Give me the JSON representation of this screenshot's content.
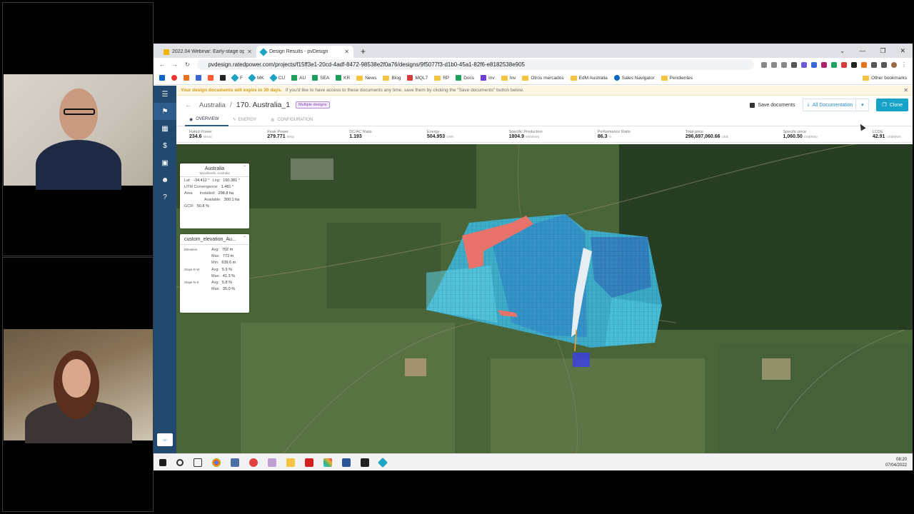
{
  "browser": {
    "tabs": [
      {
        "title": "2022.04 Webinar: Early-stage optim",
        "active": false
      },
      {
        "title": "Design Results - pvDesign",
        "active": true
      }
    ],
    "url": "pvdesign.ratedpower.com/projects/f15ff3e1-20cd-4adf-8472-98538e2f0a76/designs/9f5077f3-d1b0-45a1-82f6-e8182538e905",
    "bookmarks": [
      "F",
      "MK",
      "CU",
      "AU",
      "SEA",
      "KR",
      "News",
      "Blog",
      "MQL7",
      "RP",
      "Docs",
      "Inv",
      "Inv",
      "Otros mercados",
      "EdM Australia",
      "Sales Navigator",
      "Pendientes"
    ],
    "other_bookmarks": "Other bookmarks"
  },
  "banner": {
    "bold": "Your design documents will expire in 30 days.",
    "text": "If you'd like to have access to these documents any time, save them by clicking the \"Save documents\" button below."
  },
  "header": {
    "country": "Australia",
    "separator": "/",
    "project": "170. Australia_1",
    "tag": "Multiple designs",
    "save_label": "Save documents",
    "docs_label": "All Documentation",
    "clone_label": "Clone"
  },
  "tabs": [
    "OVERVIEW",
    "ENERGY",
    "CONFIGURATION"
  ],
  "metrics": [
    {
      "label": "Rated Power",
      "value": "234.6",
      "unit": "MWac"
    },
    {
      "label": "Peak Power",
      "value": "279.771",
      "unit": "MWp"
    },
    {
      "label": "DC/AC Ratio",
      "value": "1.193",
      "unit": ""
    },
    {
      "label": "Energy",
      "value": "504.953",
      "unit": "GWh"
    },
    {
      "label": "Specific Production",
      "value": "1804.9",
      "unit": "kWh/kWp"
    },
    {
      "label": "Performance Ratio",
      "value": "86.3",
      "unit": "%"
    },
    {
      "label": "Total price",
      "value": "296,697,060.66",
      "unit": "US$"
    },
    {
      "label": "Specific price",
      "value": "1,060.50",
      "unit": "US$/kWp"
    },
    {
      "label": "LCOE",
      "value": "42.91",
      "unit": "US$/MWh"
    }
  ],
  "location_card": {
    "title": "Australia",
    "subtitle": "Woodlands, Australia",
    "lat_label": "Lat:",
    "lat": "-34.412 °",
    "lng_label": "Lng:",
    "lng": "150.381 °",
    "utm_label": "UTM Convergence:",
    "utm": "1.481 °",
    "area_label": "Area",
    "installed_label": "Installed:",
    "installed": "298.8 ha",
    "available_label": "Available:",
    "available": "300.1 ha",
    "gcr_label": "GCR:",
    "gcr": "50.8 %"
  },
  "elevation_card": {
    "title": "custom_elevation_Au...",
    "elevation_label": "Elevation",
    "avg_label": "Avg:",
    "avg": "702 m",
    "max_label": "Max:",
    "max": "773 m",
    "min_label": "Min:",
    "min": "639.6 m",
    "slope_ew_label": "Slope E-W",
    "slope_ew_avg": "5.9 %",
    "slope_ew_max": "41.3 %",
    "slope_ns_label": "Slope N-S",
    "slope_ns_avg": "5.8 %",
    "slope_ns_max": "35.0 %"
  },
  "taskbar": {
    "time": "08:20",
    "date": "07/04/2022"
  },
  "colors": {
    "sidebar": "#22496f",
    "accent": "#17a3c9",
    "warning": "#d59b16",
    "tag": "#7a3fb0"
  }
}
